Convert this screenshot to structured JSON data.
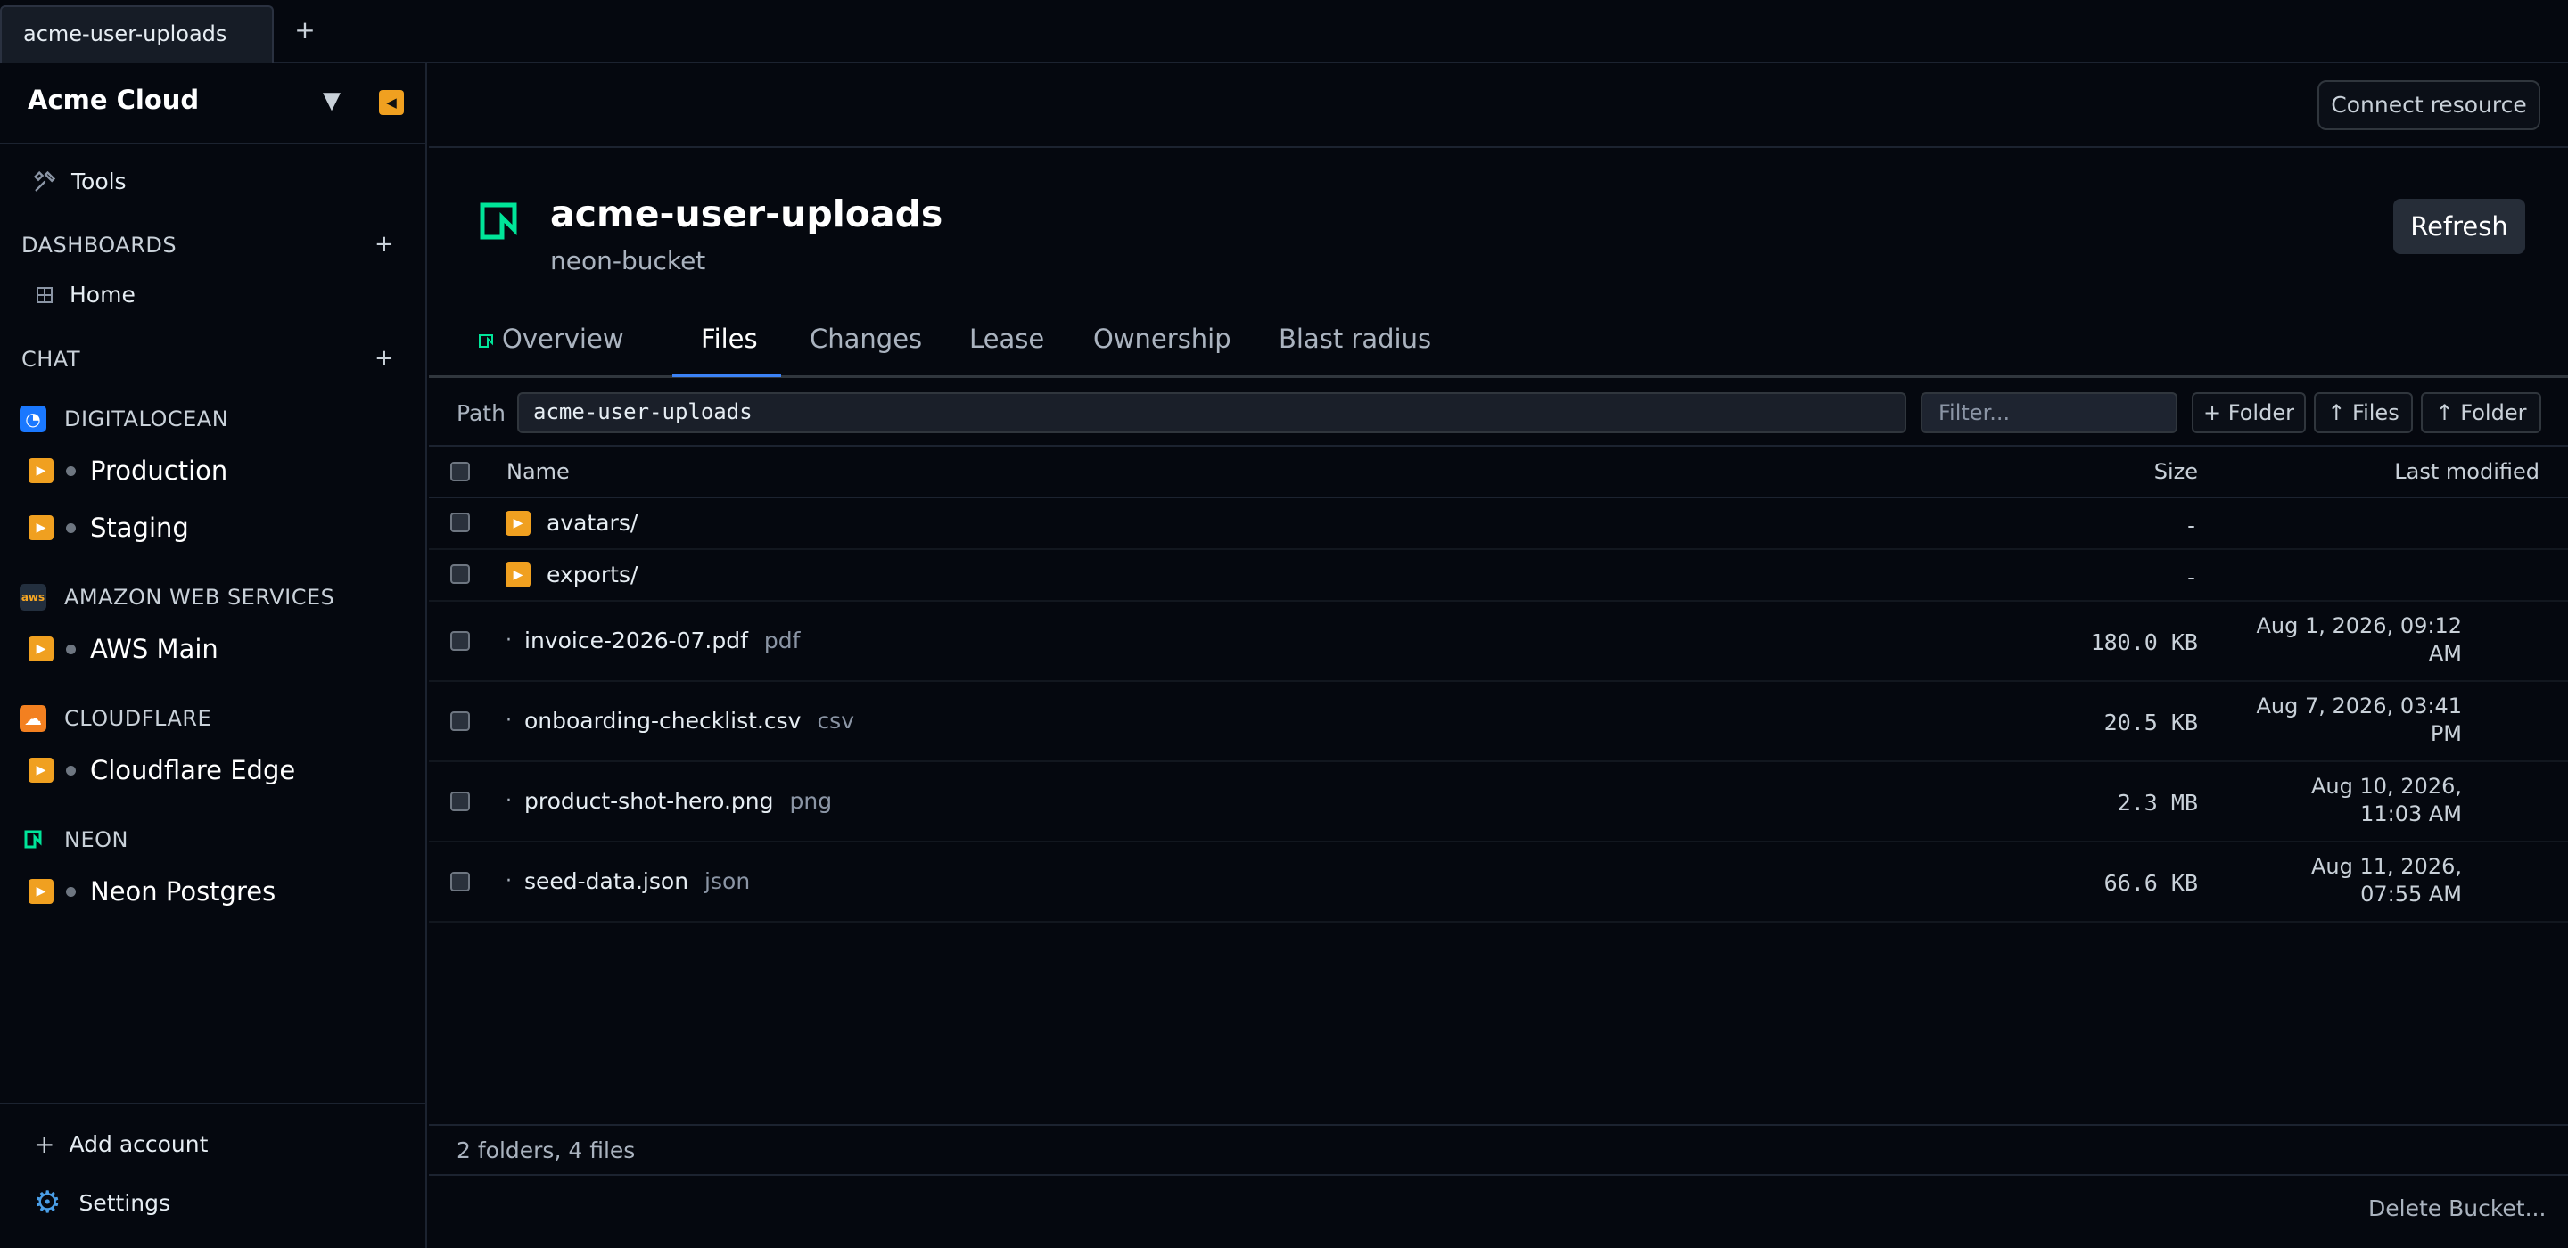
{
  "tabbar": {
    "active_tab": "acme-user-uploads",
    "add_label": "+"
  },
  "sidebar": {
    "org_name": "Acme Cloud",
    "caret": "▼",
    "collapse_glyph": "◀",
    "tools_label": "Tools",
    "dashboards": {
      "heading": "DASHBOARDS",
      "plus": "+",
      "items": [
        {
          "label": "Home",
          "icon": "grid-icon"
        }
      ]
    },
    "chat": {
      "heading": "CHAT",
      "plus": "+"
    },
    "providers": [
      {
        "name": "DIGITALOCEAN",
        "icon": "digitalocean-icon",
        "badge_text": "◔",
        "color": "#1a78ff",
        "resources": [
          {
            "label": "Production"
          },
          {
            "label": "Staging"
          }
        ]
      },
      {
        "name": "AMAZON WEB SERVICES",
        "icon": "aws-icon",
        "badge_text": "aws",
        "color": "#232f3e",
        "resources": [
          {
            "label": "AWS Main"
          }
        ]
      },
      {
        "name": "CLOUDFLARE",
        "icon": "cloudflare-icon",
        "badge_text": "☁",
        "color": "#f38020",
        "resources": [
          {
            "label": "Cloudflare Edge"
          }
        ]
      },
      {
        "name": "NEON",
        "icon": "neon-icon",
        "badge_text": "",
        "color": "#00e599",
        "resources": [
          {
            "label": "Neon Postgres"
          }
        ]
      }
    ],
    "resource_glyph": "▶",
    "footer": {
      "add_account": "Add account",
      "add_glyph": "+",
      "settings": "Settings",
      "settings_glyph": "⚙"
    }
  },
  "main": {
    "connect_button": "Connect resource",
    "resource": {
      "title": "acme-user-uploads",
      "subtitle": "neon-bucket",
      "refresh_button": "Refresh"
    },
    "tabs": [
      {
        "label": "Overview",
        "active": false
      },
      {
        "label": "Files",
        "active": true
      },
      {
        "label": "Changes",
        "active": false
      },
      {
        "label": "Lease",
        "active": false
      },
      {
        "label": "Ownership",
        "active": false
      },
      {
        "label": "Blast radius",
        "active": false
      }
    ],
    "pathbar": {
      "path_label": "Path",
      "path_value": "acme-user-uploads",
      "filter_placeholder": "Filter...",
      "new_folder_button": "+ Folder",
      "upload_files_button": "↑ Files",
      "upload_folder_button": "↑ Folder"
    },
    "table": {
      "columns": {
        "name": "Name",
        "size": "Size",
        "modified": "Last modified"
      },
      "folders": [
        {
          "name": "avatars/",
          "size": "-",
          "modified": ""
        },
        {
          "name": "exports/",
          "size": "-",
          "modified": ""
        }
      ],
      "files": [
        {
          "name": "invoice-2026-07.pdf",
          "ext": "pdf",
          "size": "180.0 KB",
          "modified_line1": "Aug 1, 2026, 09:12",
          "modified_line2": "AM"
        },
        {
          "name": "onboarding-checklist.csv",
          "ext": "csv",
          "size": "20.5 KB",
          "modified_line1": "Aug 7, 2026, 03:41",
          "modified_line2": "PM"
        },
        {
          "name": "product-shot-hero.png",
          "ext": "png",
          "size": "2.3 MB",
          "modified_line1": "Aug 10, 2026,",
          "modified_line2": "11:03 AM"
        },
        {
          "name": "seed-data.json",
          "ext": "json",
          "size": "66.6 KB",
          "modified_line1": "Aug 11, 2026,",
          "modified_line2": "07:55 AM"
        }
      ],
      "file_bullet": "·",
      "folder_glyph": "▶"
    },
    "summary": "2 folders, 4 files",
    "delete_link": "Delete Bucket..."
  }
}
